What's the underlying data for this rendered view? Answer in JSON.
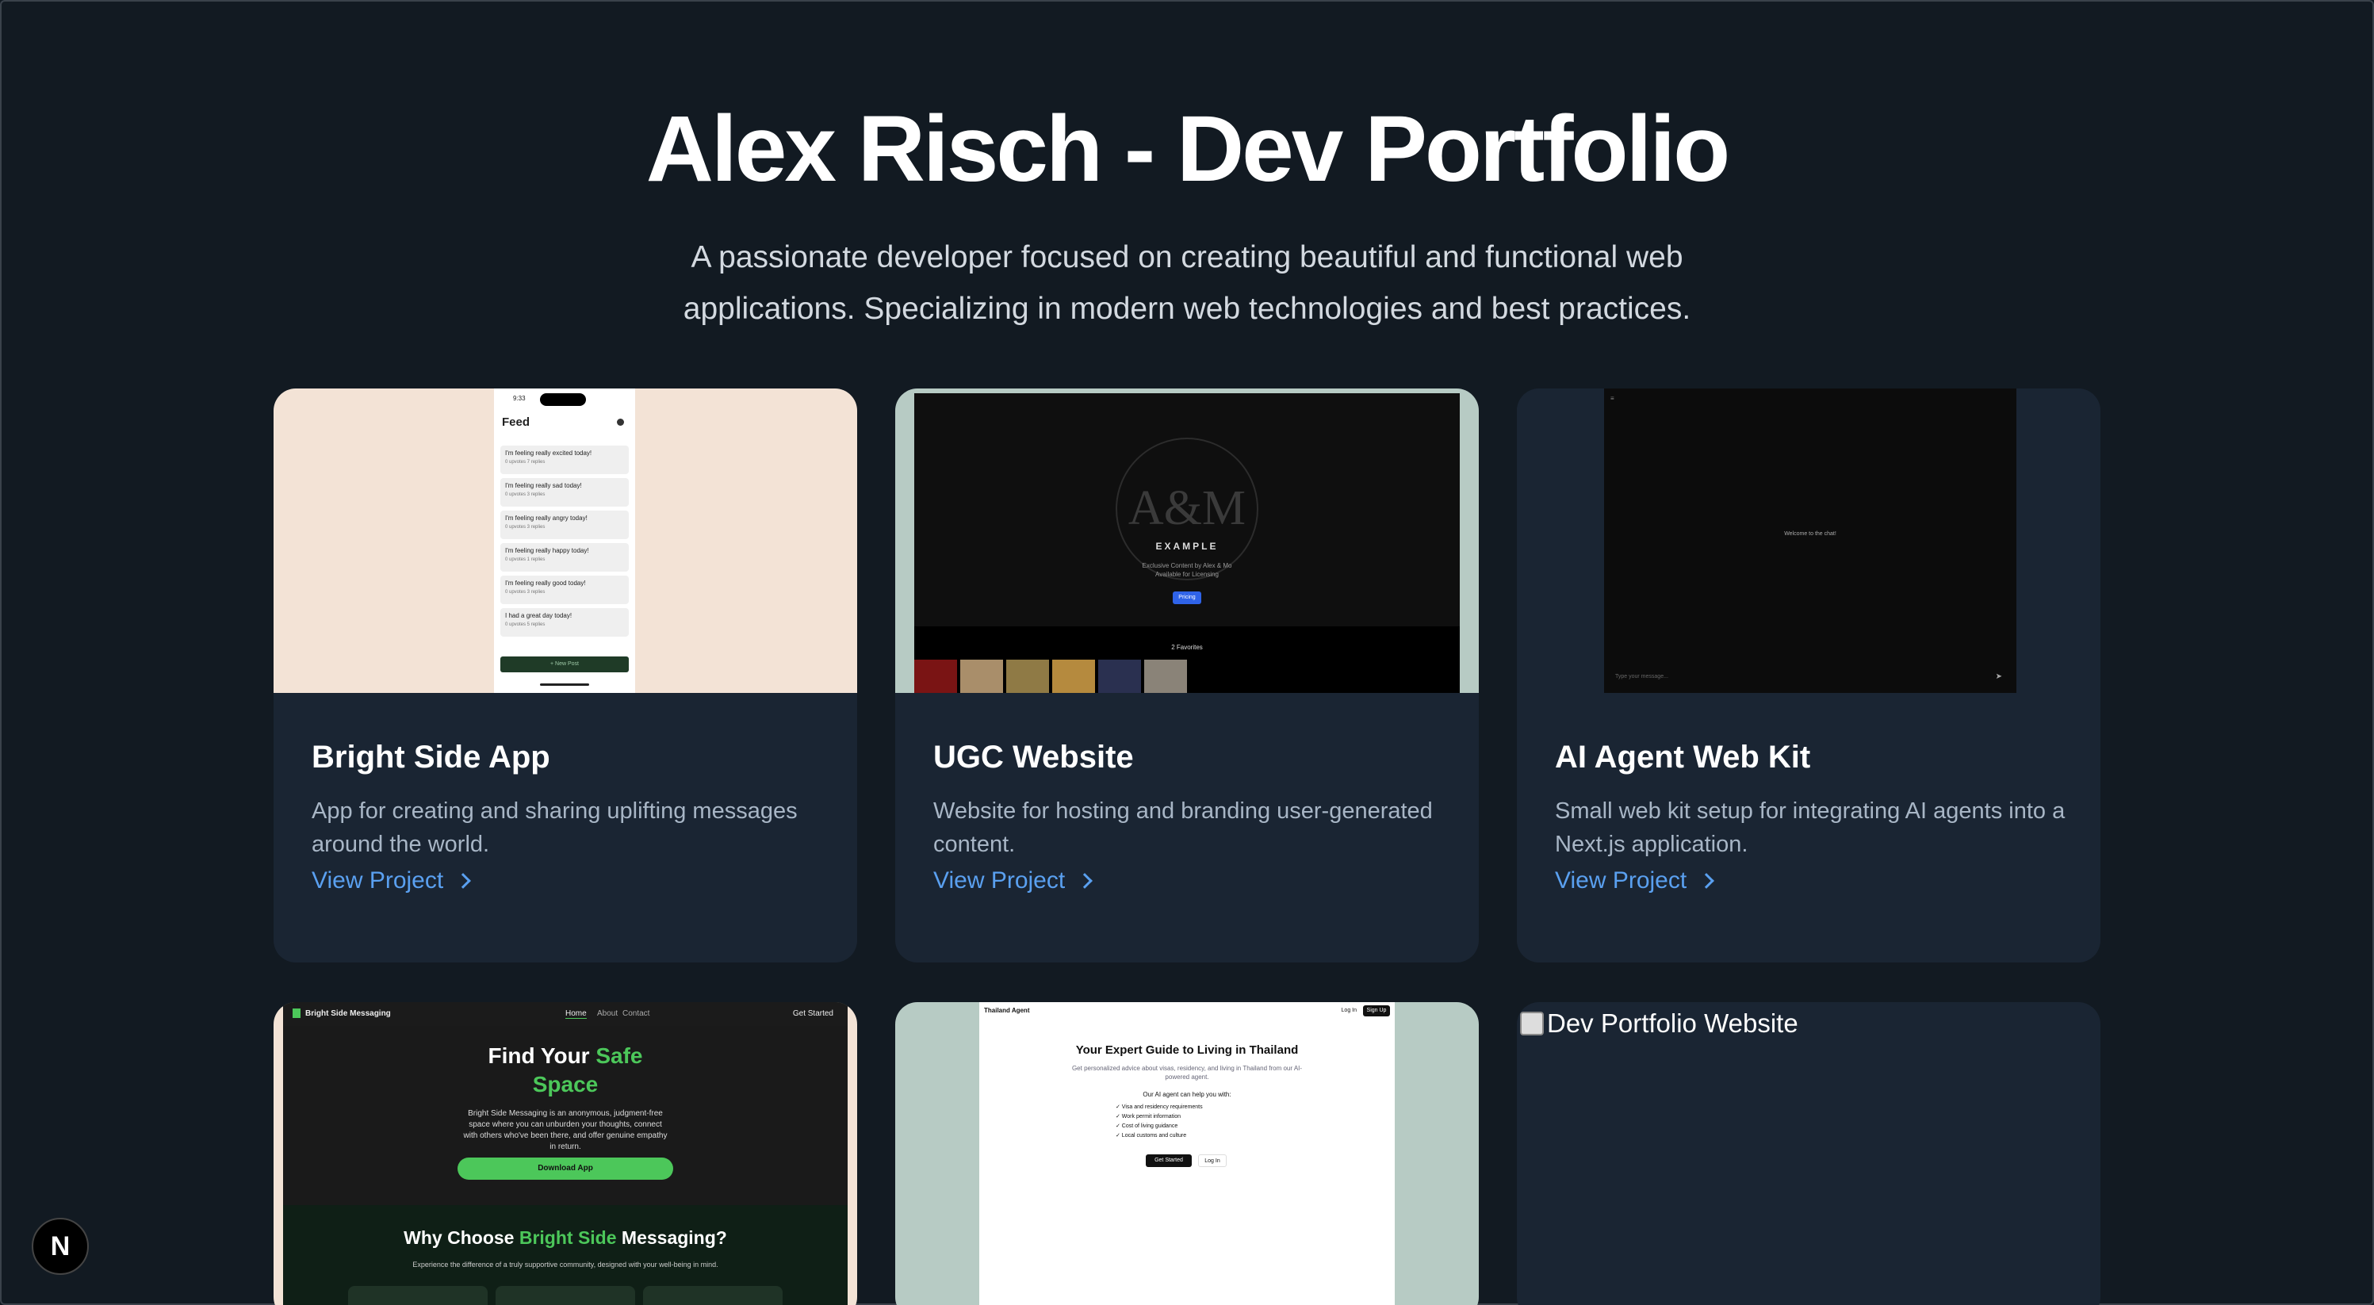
{
  "header": {
    "title": "Alex Risch - Dev Portfolio",
    "subtitle": "A passionate developer focused on creating beautiful and functional web applications. Specializing in modern web technologies and best practices."
  },
  "projects": [
    {
      "title": "Bright Side App",
      "description": "App for creating and sharing uplifting messages around the world.",
      "link_label": "View Project",
      "preview": {
        "time": "9:33",
        "screen_title": "Feed",
        "posts": [
          {
            "text": "I'm feeling really excited today!",
            "meta": "0 upvotes   7 replies"
          },
          {
            "text": "I'm feeling really sad today!",
            "meta": "0 upvotes   3 replies"
          },
          {
            "text": "I'm feeling really angry today!",
            "meta": "0 upvotes   3 replies"
          },
          {
            "text": "I'm feeling really happy today!",
            "meta": "0 upvotes   1 replies"
          },
          {
            "text": "I'm feeling really good today!",
            "meta": "0 upvotes   3 replies"
          },
          {
            "text": "I had a great day today!",
            "meta": "0 upvotes   5 replies"
          }
        ],
        "button": "+ New Post"
      }
    },
    {
      "title": "UGC Website",
      "description": "Website for hosting and branding user-generated content.",
      "link_label": "View Project",
      "preview": {
        "monogram": "A&M",
        "label": "EXAMPLE",
        "sub1": "Exclusive Content by Alex & Mo",
        "sub2": "Available for Licensing",
        "button": "Pricing",
        "favorites": "2 Favorites",
        "photo_colors": [
          "#7a1414",
          "#a98e6a",
          "#8f7a45",
          "#b58a3e",
          "#2a3050",
          "#8a8378"
        ]
      }
    },
    {
      "title": "AI Agent Web Kit",
      "description": "Small web kit setup for integrating AI agents into a Next.js application.",
      "link_label": "View Project",
      "preview": {
        "welcome": "Welcome to the chat!",
        "input_placeholder": "Type your message..."
      }
    },
    {
      "title": "Bright Side Messaging",
      "preview": {
        "brand": "Bright Side Messaging",
        "nav": [
          "Home",
          "About",
          "Contact"
        ],
        "cta": "Get Started",
        "headline_a": "Find Your ",
        "headline_b": "Safe",
        "headline_c": "Space",
        "body": "Bright Side Messaging is an anonymous, judgment-free space where you can unburden your thoughts, connect with others who've been there, and offer genuine empathy in return.",
        "download": "Download App",
        "why_a": "Why Choose ",
        "why_b": "Bright Side",
        "why_c": " Messaging?",
        "why_sub": "Experience the difference of a truly supportive community, designed with your well-being in mind."
      }
    },
    {
      "title": "Thailand Agent",
      "preview": {
        "brand": "Thailand Agent",
        "login": "Log In",
        "signup": "Sign Up",
        "headline": "Your Expert Guide to Living in Thailand",
        "sub": "Get personalized advice about visas, residency, and living in Thailand from our AI-powered agent.",
        "can_help": "Our AI agent can help you with:",
        "items": [
          "✓ Visa and residency requirements",
          "✓ Work permit information",
          "✓ Cost of living guidance",
          "✓ Local customs and culture"
        ],
        "get_started": "Get Started",
        "log_in": "Log In"
      }
    },
    {
      "title": "Dev Portfolio Website",
      "image_alt": "Dev Portfolio Website"
    }
  ],
  "badge": {
    "label": "N"
  },
  "colors": {
    "background": "#121a22",
    "card": "#1a2533",
    "link": "#5aa0f0",
    "accent_green": "#4cc75a"
  }
}
